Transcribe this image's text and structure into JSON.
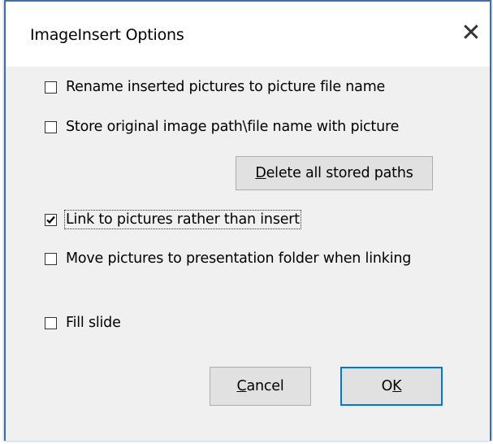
{
  "dialog": {
    "title": "ImageInsert Options",
    "close_glyph": "✕"
  },
  "options": [
    {
      "label": "Rename inserted pictures to picture file name",
      "checked": false
    },
    {
      "label": "Store original image path\\file name with picture",
      "checked": false
    },
    {
      "label": "Link to pictures rather than insert",
      "checked": true
    },
    {
      "label": "Move pictures to presentation folder when linking",
      "checked": false
    },
    {
      "label": "Fill slide",
      "checked": false
    }
  ],
  "buttons": {
    "delete_paths": {
      "mnemonic": "D",
      "rest": "elete all stored paths"
    },
    "cancel": {
      "mnemonic": "C",
      "rest": "ancel"
    },
    "ok": {
      "pre": "O",
      "mnemonic": "K"
    }
  },
  "colors": {
    "accent": "#0078d7",
    "frame": "#3f6eaa",
    "dialog_bg": "#f0f0f0",
    "button_bg": "#e1e1e1"
  }
}
